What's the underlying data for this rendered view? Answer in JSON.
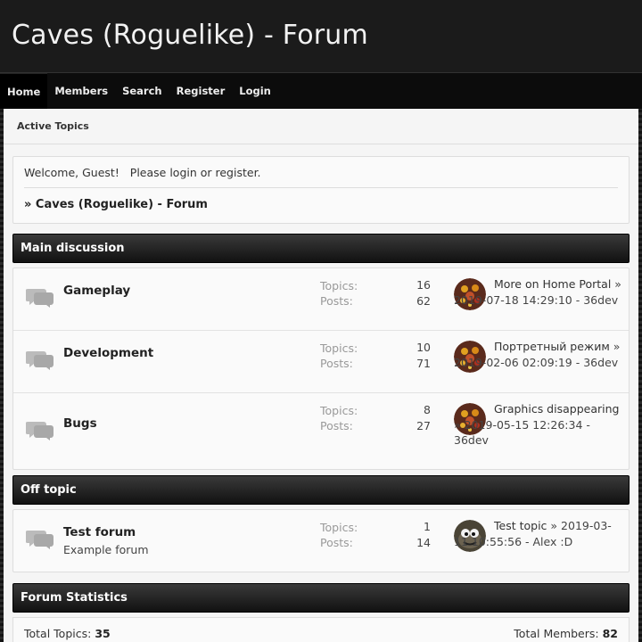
{
  "site": {
    "title": "Caves (Roguelike) - Forum"
  },
  "nav": {
    "items": [
      {
        "label": "Home",
        "active": true
      },
      {
        "label": "Members"
      },
      {
        "label": "Search"
      },
      {
        "label": "Register"
      },
      {
        "label": "Login"
      }
    ]
  },
  "page_tab": "Active Topics",
  "welcome": {
    "prefix": "Welcome, Guest!",
    "text": "Please login or register.",
    "breadcrumb": "» Caves (Roguelike) - Forum"
  },
  "categories": [
    {
      "title": "Main discussion",
      "boards": [
        {
          "name": "Gameplay",
          "description": "",
          "topics_label": "Topics:",
          "topics": "16",
          "posts_label": "Posts:",
          "posts": "62",
          "last_post": {
            "title": "More on Home Portal",
            "arrow": "»",
            "date": "2019-07-18 14:29:10",
            "author": "36dev"
          }
        },
        {
          "name": "Development",
          "description": "",
          "topics_label": "Topics:",
          "topics": "10",
          "posts_label": "Posts:",
          "posts": "71",
          "last_post": {
            "title": "Портретный режим",
            "arrow": "»",
            "date": "2019-02-06 02:09:19",
            "author": "36dev"
          }
        },
        {
          "name": "Bugs",
          "description": "",
          "topics_label": "Topics:",
          "topics": "8",
          "posts_label": "Posts:",
          "posts": "27",
          "last_post": {
            "title": "Graphics disappearing",
            "arrow": "»",
            "date": "2019-05-15 12:26:34",
            "author": "36dev"
          }
        }
      ]
    },
    {
      "title": "Off topic",
      "boards": [
        {
          "name": "Test forum",
          "description": "Example forum",
          "topics_label": "Topics:",
          "topics": "1",
          "posts_label": "Posts:",
          "posts": "14",
          "last_post": {
            "title": "Test topic",
            "arrow": "»",
            "date": "2019-03-11 10:55:56",
            "author": "Alex :D"
          }
        }
      ]
    }
  ],
  "statistics": {
    "title": "Forum Statistics",
    "total_topics_label": "Total Topics:",
    "total_topics": "35",
    "total_members_label": "Total Members:",
    "total_members": "82"
  },
  "colors": {
    "header_bg": "#1b1b1b",
    "nav_bg": "#0c0c0c",
    "section_head": "#222222",
    "content_bg": "#f5f5f5"
  }
}
